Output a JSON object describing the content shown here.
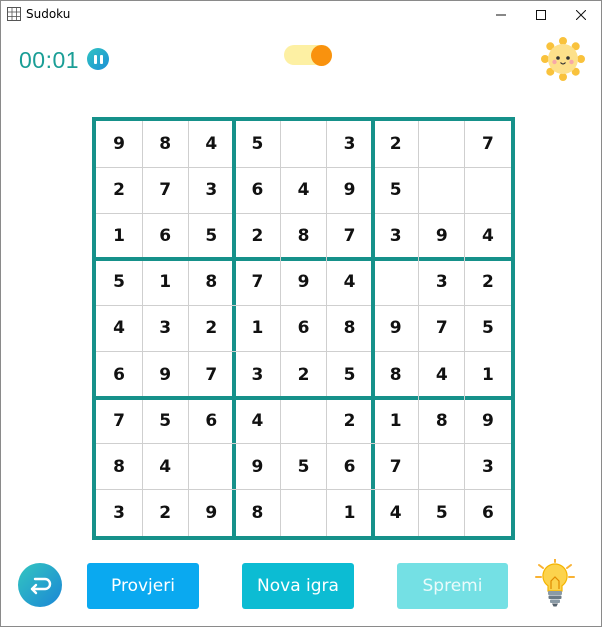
{
  "window": {
    "title": "Sudoku",
    "controls": [
      "minimize",
      "maximize",
      "close"
    ]
  },
  "header": {
    "timer": "00:01",
    "pause_icon": "pause-icon",
    "theme_toggle": {
      "state": "on",
      "track_color": "#fdf0a3",
      "knob_color": "#f9920e"
    },
    "sun_icon": "sun-mascot-icon"
  },
  "board": {
    "border_color": "#16918a",
    "grid": [
      [
        "9",
        "8",
        "4",
        "5",
        "",
        "3",
        "2",
        "",
        "7"
      ],
      [
        "2",
        "7",
        "3",
        "6",
        "4",
        "9",
        "5",
        "",
        ""
      ],
      [
        "1",
        "6",
        "5",
        "2",
        "8",
        "7",
        "3",
        "9",
        "4"
      ],
      [
        "5",
        "1",
        "8",
        "7",
        "9",
        "4",
        "",
        "3",
        "2"
      ],
      [
        "4",
        "3",
        "2",
        "1",
        "6",
        "8",
        "9",
        "7",
        "5"
      ],
      [
        "6",
        "9",
        "7",
        "3",
        "2",
        "5",
        "8",
        "4",
        "1"
      ],
      [
        "7",
        "5",
        "6",
        "4",
        "",
        "2",
        "1",
        "8",
        "9"
      ],
      [
        "8",
        "4",
        "",
        "9",
        "5",
        "6",
        "7",
        "",
        "3"
      ],
      [
        "3",
        "2",
        "9",
        "8",
        "",
        "1",
        "4",
        "5",
        "6"
      ]
    ]
  },
  "footer": {
    "back_icon": "undo-arrow-icon",
    "check_label": "Provjeri",
    "new_game_label": "Nova igra",
    "save_label": "Spremi",
    "hint_icon": "lightbulb-icon"
  }
}
